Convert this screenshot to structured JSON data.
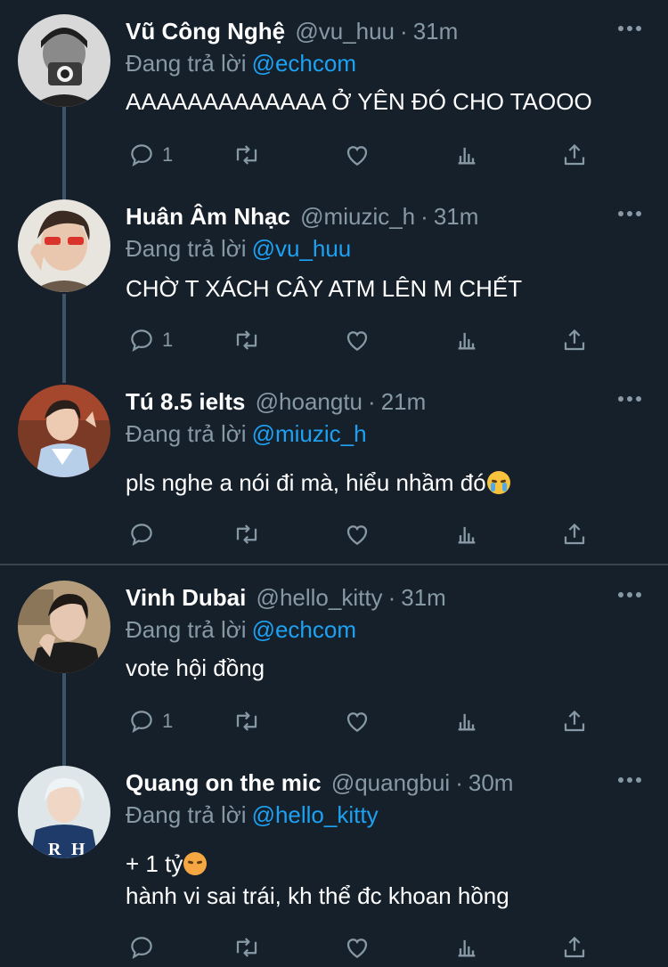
{
  "tweets": [
    {
      "name": "Vũ Công Nghệ",
      "handle": "@vu_huu",
      "time": "31m",
      "reply_prefix": "Đang trả lời",
      "reply_to": "@echcom",
      "lines": [
        "AAAAAAAAAAAAA Ở YÊN ĐÓ CHO TAOOO"
      ],
      "reply_count": "1"
    },
    {
      "name": "Huân Âm Nhạc",
      "handle": "@miuzic_h",
      "time": "31m",
      "reply_prefix": "Đang trả lời",
      "reply_to": "@vu_huu",
      "lines": [
        "CHỜ T XÁCH CÂY ATM LÊN M CHẾT"
      ],
      "reply_count": "1"
    },
    {
      "name": "Tú 8.5 ielts",
      "handle": "@hoangtu",
      "time": "21m",
      "reply_prefix": "Đang trả lời",
      "reply_to": "@miuzic_h",
      "lines": [
        "pls nghe a nói đi mà, hiểu nhầm đó"
      ],
      "emoji": "loudly-crying-face",
      "reply_count": ""
    },
    {
      "name": "Vinh Dubai",
      "handle": "@hello_kitty",
      "time": "31m",
      "reply_prefix": "Đang trả lời",
      "reply_to": "@echcom",
      "lines": [
        "vote hội đồng"
      ],
      "reply_count": "1"
    },
    {
      "name": "Quang on the mic",
      "handle": "@quangbui",
      "time": "30m",
      "reply_prefix": "Đang trả lời",
      "reply_to": "@hello_kitty",
      "lines": [
        "+ 1 tỷ",
        "hành vi sai trái, kh thể đc khoan hồng"
      ],
      "emoji": "persevering-face",
      "reply_count": ""
    }
  ],
  "icons": {
    "reply": "reply-icon",
    "retweet": "retweet-icon",
    "like": "heart-icon",
    "analytics": "analytics-icon",
    "share": "share-icon",
    "more": "more-icon"
  },
  "colors": {
    "background": "#15202b",
    "secondary_text": "#8899a6",
    "link": "#1da1f2",
    "divider": "#38444d",
    "thread_line": "#3d5466"
  }
}
